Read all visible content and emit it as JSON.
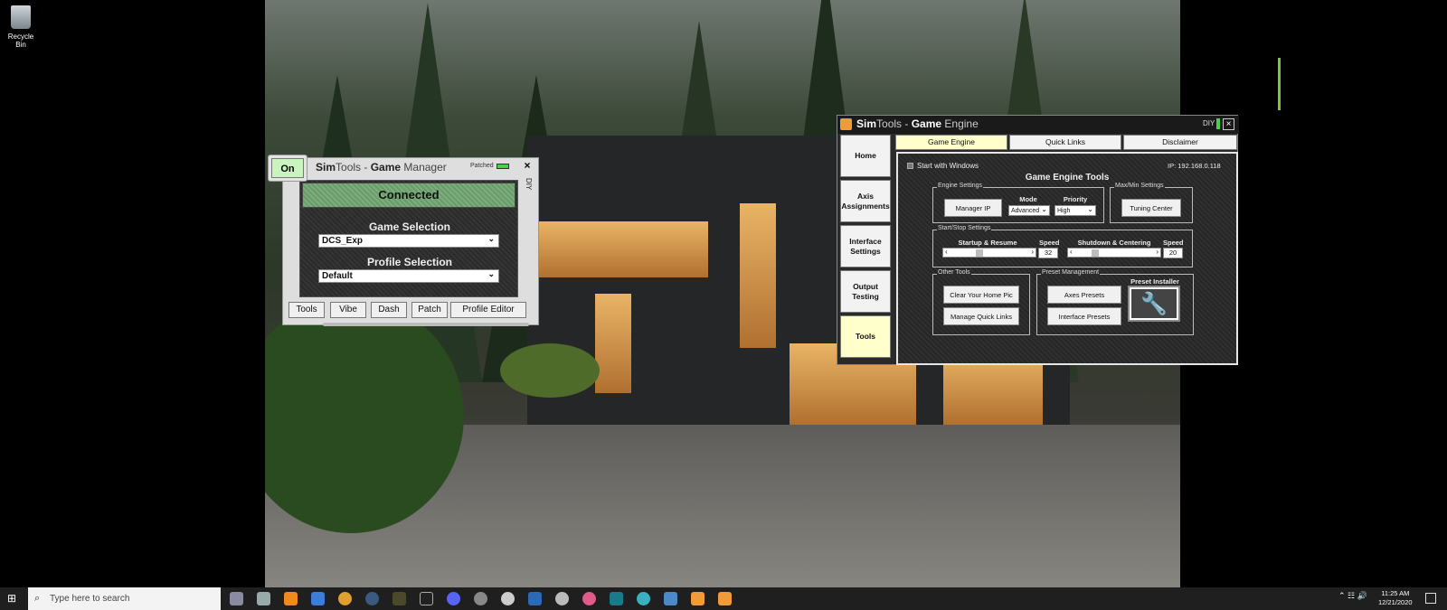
{
  "desktop": {
    "recycle_bin_label": "Recycle Bin"
  },
  "game_manager": {
    "on_label": "On",
    "title_sim": "Sim",
    "title_tools": "Tools - ",
    "title_game": "Game",
    "title_manager": " Manager",
    "patched_label": "Patched",
    "close_icon": "×",
    "diy_label": "DIY",
    "status": "Connected",
    "game_selection_label": "Game Selection",
    "game_selection_value": "DCS_Exp",
    "profile_selection_label": "Profile Selection",
    "profile_selection_value": "Default",
    "buttons": [
      "Tools",
      "Vibe",
      "Dash",
      "Patch",
      "Profile Editor"
    ]
  },
  "game_engine": {
    "title_sim": "Sim",
    "title_tools": "Tools - ",
    "title_game": "Game",
    "title_engine": " Engine",
    "diy_label": "DIY",
    "close_icon": "×",
    "side_nav": [
      "Home",
      "Axis Assignments",
      "Interface Settings",
      "Output Testing",
      "Tools"
    ],
    "tabs": [
      "Game Engine",
      "Quick Links",
      "Disclaimer"
    ],
    "start_with_windows": "Start with Windows",
    "ip_label": "IP: 192.168.0.118",
    "heading": "Game Engine Tools",
    "engine_settings": {
      "group_label": "Engine Settings",
      "manager_ip_button": "Manager IP",
      "mode_label": "Mode",
      "mode_value": "Advanced",
      "priority_label": "Priority",
      "priority_value": "High"
    },
    "maxmin_settings": {
      "group_label": "Max/Min Settings",
      "tuning_center_button": "Tuning Center"
    },
    "startstop_settings": {
      "group_label": "Start/Stop Settings",
      "startup_label": "Startup & Resume",
      "speed_label": "Speed",
      "startup_speed": "32",
      "shutdown_label": "Shutdown & Centering",
      "shutdown_speed": "20"
    },
    "other_tools": {
      "group_label": "Other Tools",
      "clear_home_pic": "Clear Your Home Pic",
      "manage_quick_links": "Manage Quick Links"
    },
    "preset_management": {
      "group_label": "Preset Management",
      "axes_presets": "Axes Presets",
      "interface_presets": "Interface Presets",
      "preset_installer_label": "Preset Installer",
      "wrench_icon": "🔧"
    }
  },
  "taskbar": {
    "search_placeholder": "Type here to search",
    "time": "11:25 AM",
    "date": "12/21/2020"
  }
}
